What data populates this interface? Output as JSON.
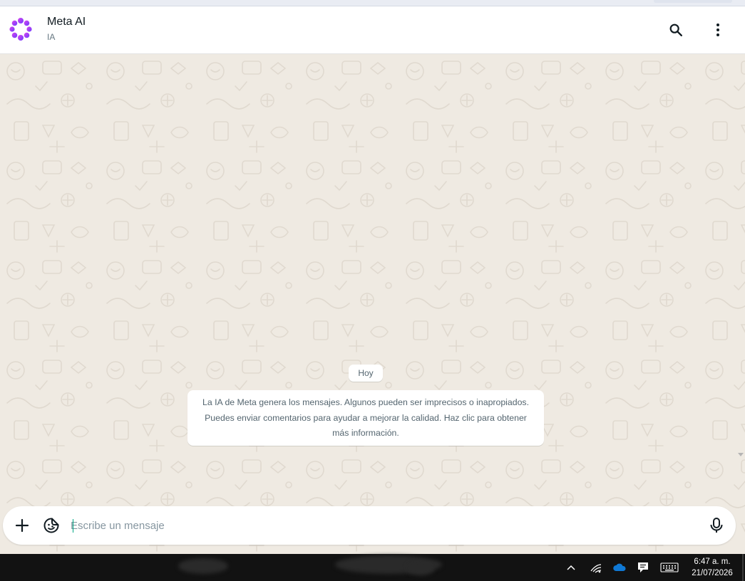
{
  "header": {
    "contact_name": "Meta AI",
    "contact_subtitle": "IA",
    "icons": {
      "avatar": "meta-ai-ring-icon",
      "search": "search-icon",
      "menu": "more-vertical-icon"
    }
  },
  "chat": {
    "date_label": "Hoy",
    "system_message": "La IA de Meta genera los mensajes. Algunos pueden ser imprecisos o inapropiados. Puedes enviar comentarios para ayudar a mejorar la calidad. Haz clic para obtener más información."
  },
  "composer": {
    "placeholder": "Escribe un mensaje",
    "value": "",
    "icons": {
      "attach": "plus-icon",
      "sticker": "sticker-icon",
      "voice": "microphone-icon"
    }
  },
  "taskbar": {
    "time": "6:47 a. m.",
    "date": "21/07/2026",
    "tray_icons": [
      "chevron-up-icon",
      "wifi-icon",
      "onedrive-cloud-icon",
      "notification-icon",
      "keyboard-icon"
    ]
  },
  "colors": {
    "accent": "#00a884",
    "chat_background": "#efeae2",
    "avatar_purple": "#8a4fff",
    "avatar_pink": "#d946ef",
    "onedrive_blue": "#0f78d4"
  }
}
